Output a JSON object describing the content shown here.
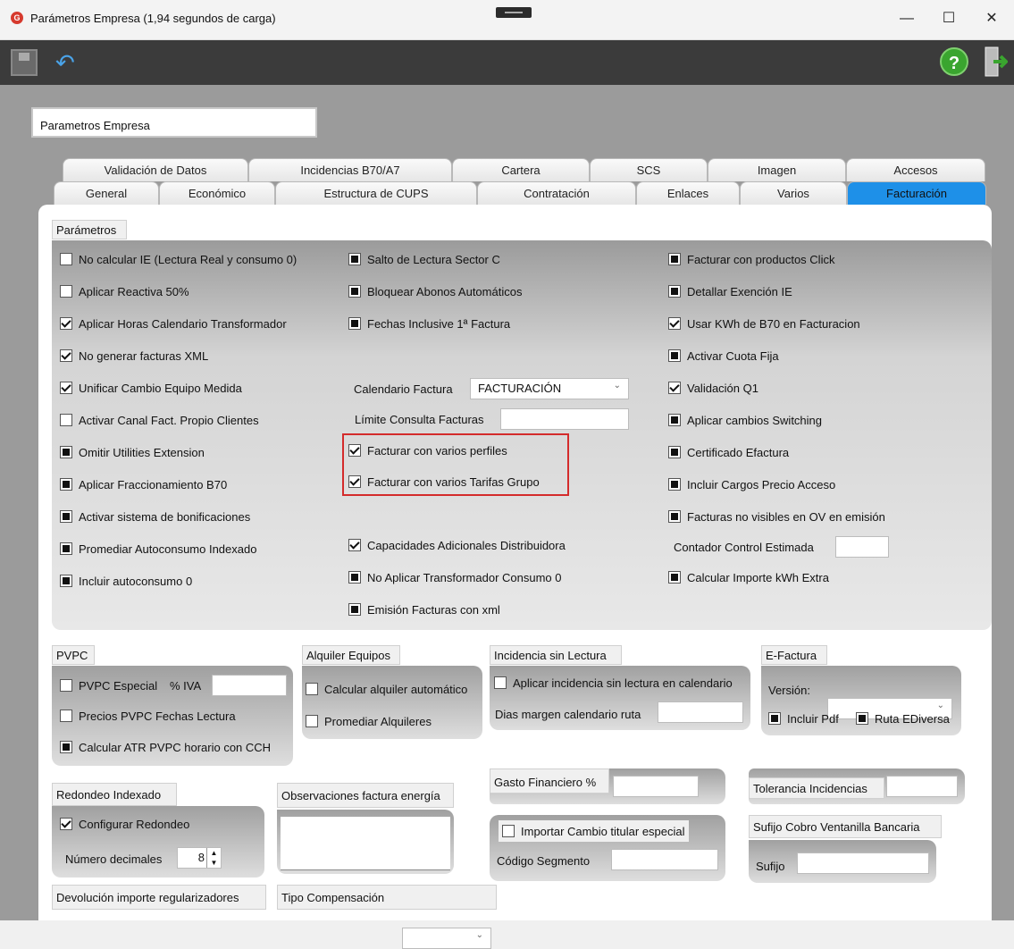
{
  "window": {
    "title": "Parámetros Empresa (1,94 segundos de carga)",
    "app_icon": "app-logo-icon",
    "min": "—",
    "max": "☐",
    "close": "✕"
  },
  "toolbar": {
    "save": "save-icon",
    "undo": "undo-icon",
    "help": "?",
    "exit": "exit-icon"
  },
  "header": {
    "title": "Parametros Empresa"
  },
  "tabs_row1": [
    "Validación de Datos",
    "Incidencias B70/A7",
    "Cartera",
    "SCS",
    "Imagen",
    "Accesos"
  ],
  "tabs_row2": [
    "General",
    "Económico",
    "Estructura de CUPS",
    "Contratación",
    "Enlaces",
    "Varios",
    "Facturación"
  ],
  "active_tab": "Facturación",
  "params": {
    "label": "Parámetros",
    "col1": [
      {
        "label": "No calcular IE (Lectura Real y consumo 0)",
        "state": "unchecked"
      },
      {
        "label": "Aplicar Reactiva 50%",
        "state": "unchecked"
      },
      {
        "label": "Aplicar Horas Calendario Transformador",
        "state": "checked"
      },
      {
        "label": "No generar facturas XML",
        "state": "checked"
      },
      {
        "label": "Unificar Cambio Equipo Medida",
        "state": "checked"
      },
      {
        "label": "Activar Canal Fact. Propio Clientes",
        "state": "unchecked"
      },
      {
        "label": "Omitir Utilities Extension",
        "state": "indeterminate"
      },
      {
        "label": "Aplicar Fraccionamiento B70",
        "state": "indeterminate"
      },
      {
        "label": "Activar sistema de bonificaciones",
        "state": "indeterminate"
      },
      {
        "label": "Promediar Autoconsumo Indexado",
        "state": "indeterminate"
      },
      {
        "label": "Incluir autoconsumo 0",
        "state": "indeterminate"
      }
    ],
    "col2": [
      {
        "label": "Salto de Lectura Sector C",
        "state": "indeterminate"
      },
      {
        "label": "Bloquear Abonos Automáticos",
        "state": "indeterminate"
      },
      {
        "label": "Fechas Inclusive 1ª Factura",
        "state": "indeterminate"
      }
    ],
    "calendario_label": "Calendario Factura",
    "calendario_value": "FACTURACIÓN",
    "limite_label": "Límite Consulta Facturas",
    "limite_value": "",
    "col2b": [
      {
        "label": "Facturar con varios perfiles",
        "state": "checked"
      },
      {
        "label": "Facturar con varios Tarifas Grupo",
        "state": "checked"
      }
    ],
    "col2c": [
      {
        "label": "Capacidades Adicionales Distribuidora",
        "state": "checked"
      },
      {
        "label": "No Aplicar Transformador Consumo 0",
        "state": "indeterminate"
      },
      {
        "label": "Emisión Facturas con xml",
        "state": "indeterminate"
      }
    ],
    "col3": [
      {
        "label": "Facturar con productos Click",
        "state": "indeterminate"
      },
      {
        "label": "Detallar Exención IE",
        "state": "indeterminate"
      },
      {
        "label": "Usar KWh de B70 en Facturacion",
        "state": "checked"
      },
      {
        "label": "Activar Cuota Fija",
        "state": "indeterminate"
      },
      {
        "label": "Validación Q1",
        "state": "checked"
      },
      {
        "label": "Aplicar cambios Switching",
        "state": "indeterminate"
      },
      {
        "label": "Certificado Efactura",
        "state": "indeterminate"
      },
      {
        "label": "Incluir Cargos Precio Acceso",
        "state": "indeterminate"
      },
      {
        "label": "Facturas no visibles en OV en emisión",
        "state": "indeterminate"
      }
    ],
    "contador_label": "Contador Control Estimada",
    "col3b": [
      {
        "label": "Calcular Importe kWh Extra",
        "state": "indeterminate"
      }
    ]
  },
  "pvpc": {
    "label": "PVPC",
    "especial": "PVPC Especial",
    "iva_label": "% IVA",
    "fechas": "Precios PVPC Fechas Lectura",
    "atr": "Calcular ATR PVPC horario con CCH"
  },
  "alquiler": {
    "label": "Alquiler Equipos",
    "calc": "Calcular alquiler automático",
    "prom": "Promediar Alquileres"
  },
  "incidencia": {
    "label": "Incidencia sin Lectura",
    "aplicar": "Aplicar incidencia sin lectura en calendario",
    "dias": "Dias margen calendario ruta"
  },
  "efactura": {
    "label": "E-Factura",
    "version": "Versión:",
    "pdf": "Incluir Pdf",
    "ruta": "Ruta EDiversa"
  },
  "redondeo": {
    "label": "Redondeo Indexado",
    "config": "Configurar Redondeo",
    "num_label": "Número decimales",
    "num_value": "8"
  },
  "observaciones": {
    "label": "Observaciones factura energía"
  },
  "gasto": {
    "label": "Gasto Financiero %"
  },
  "importar": {
    "label": "Importar Cambio titular especial",
    "codigo": "Código Segmento"
  },
  "tolerancia": {
    "label": "Tolerancia Incidencias"
  },
  "sufijo": {
    "label": "Sufijo Cobro Ventanilla Bancaria",
    "field": "Sufijo"
  },
  "devolucion": {
    "label": "Devolución importe regularizadores"
  },
  "compensacion": {
    "label": "Tipo Compensación"
  },
  "colors": {
    "accent": "#1e90e8",
    "highlight": "#d42b2b",
    "toolbar": "#3b3b3b",
    "background": "#9b9b9b"
  }
}
